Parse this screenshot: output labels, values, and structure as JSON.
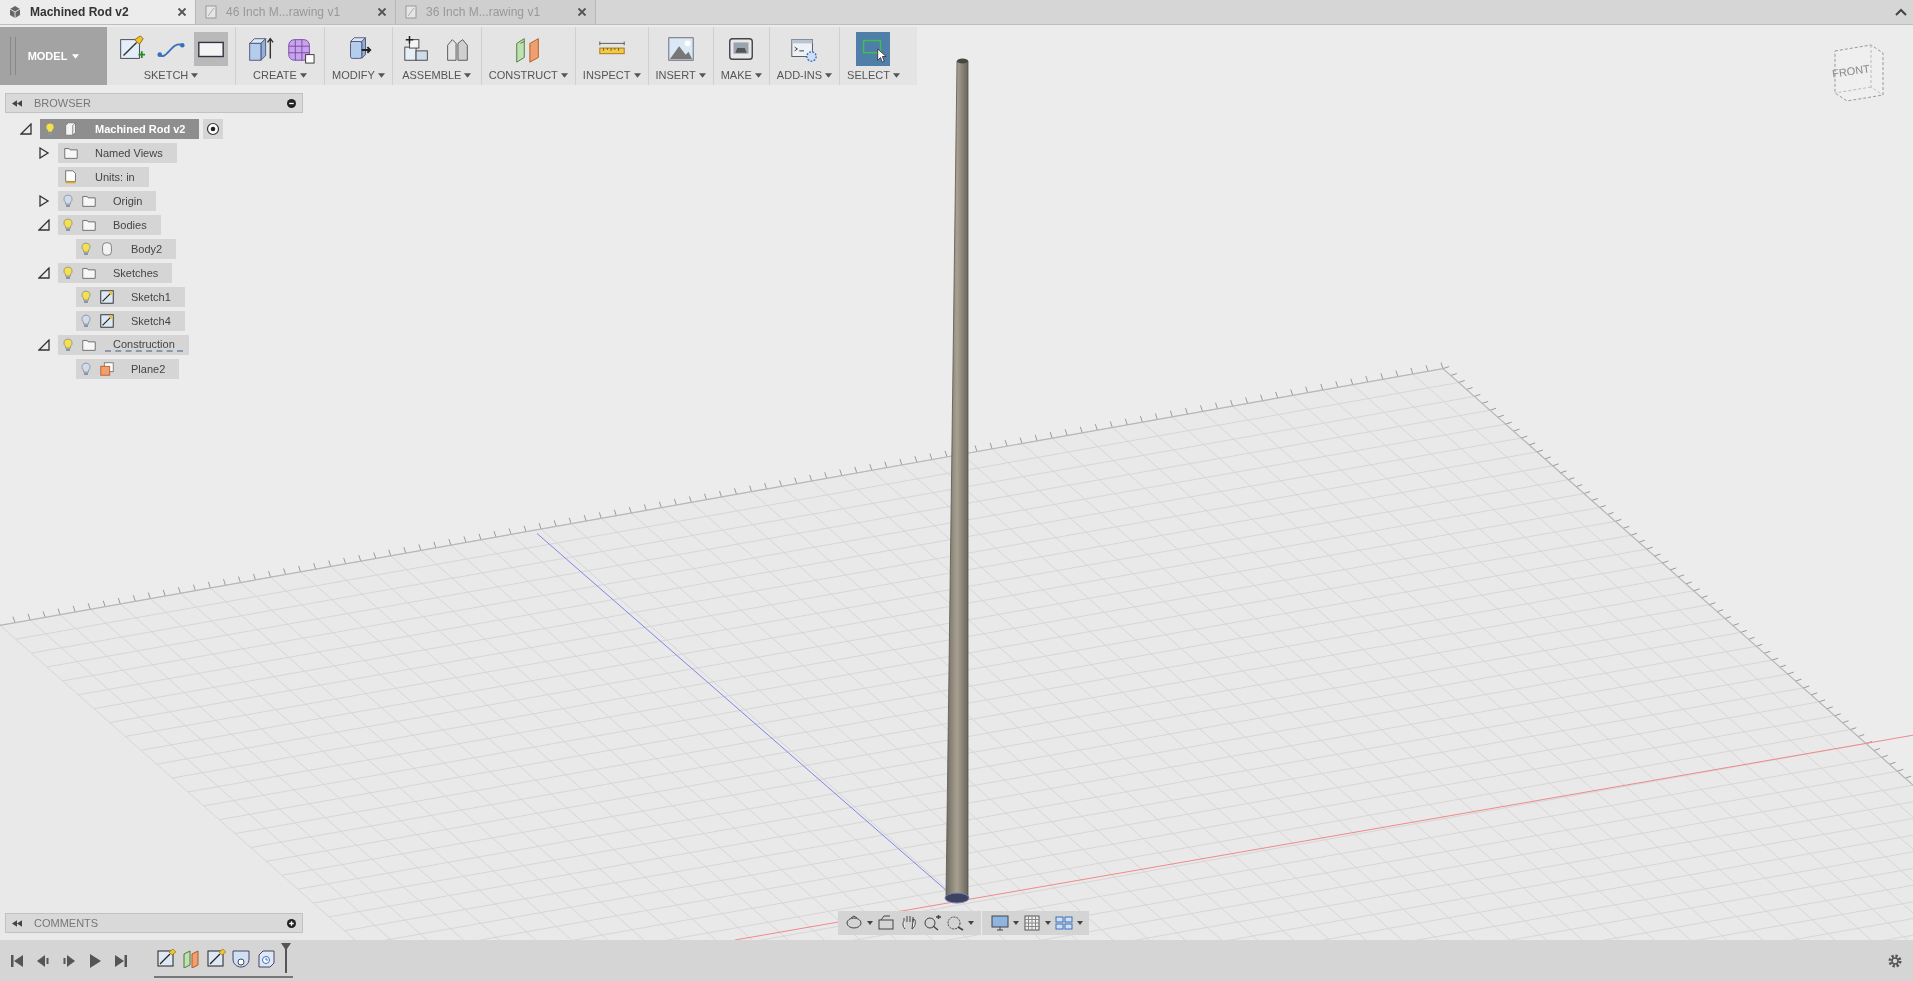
{
  "tabs": [
    {
      "label": "Machined Rod v2",
      "kind": "model",
      "selected": true
    },
    {
      "label": "46 Inch M...rawing v1",
      "kind": "drawing",
      "selected": false
    },
    {
      "label": "36 Inch M...rawing v1",
      "kind": "drawing",
      "selected": false
    }
  ],
  "toolbar": {
    "workspace": "MODEL",
    "groups": [
      {
        "label": "SKETCH",
        "tools": [
          {
            "kind": "sketch",
            "selected": false
          },
          {
            "kind": "spline",
            "selected": false
          },
          {
            "kind": "rectangle",
            "selected": true
          }
        ]
      },
      {
        "label": "CREATE",
        "tools": [
          {
            "kind": "box",
            "selected": false
          },
          {
            "kind": "form",
            "selected": false
          }
        ]
      },
      {
        "label": "MODIFY",
        "tools": [
          {
            "kind": "presspull",
            "selected": false
          }
        ]
      },
      {
        "label": "ASSEMBLE",
        "tools": [
          {
            "kind": "component",
            "selected": false
          },
          {
            "kind": "joint",
            "selected": false
          }
        ]
      },
      {
        "label": "CONSTRUCT",
        "tools": [
          {
            "kind": "plane",
            "selected": false
          }
        ]
      },
      {
        "label": "INSPECT",
        "tools": [
          {
            "kind": "measure",
            "selected": false
          }
        ]
      },
      {
        "label": "INSERT",
        "tools": [
          {
            "kind": "image",
            "selected": false
          }
        ]
      },
      {
        "label": "MAKE",
        "tools": [
          {
            "kind": "printer",
            "selected": false
          }
        ]
      },
      {
        "label": "ADD-INS",
        "tools": [
          {
            "kind": "scripts",
            "selected": false
          }
        ]
      },
      {
        "label": "SELECT",
        "tools": [
          {
            "kind": "select",
            "selected": true
          }
        ]
      }
    ]
  },
  "browser": {
    "title": "BROWSER",
    "tree": [
      {
        "label": "Machined Rod v2",
        "kind": "component",
        "visible": true,
        "expanded": true,
        "selected": true,
        "children": [
          {
            "label": "Named Views",
            "kind": "folder",
            "expanded": false,
            "selected": false
          },
          {
            "label": "Units: in",
            "kind": "units",
            "selected": false
          },
          {
            "label": "Origin",
            "kind": "folder",
            "visible": false,
            "expanded": false,
            "selected": false
          },
          {
            "label": "Bodies",
            "kind": "folder",
            "visible": true,
            "expanded": true,
            "selected": false,
            "children": [
              {
                "label": "Body2",
                "kind": "body",
                "visible": true,
                "selected": false
              }
            ]
          },
          {
            "label": "Sketches",
            "kind": "folder",
            "visible": true,
            "expanded": true,
            "selected": false,
            "children": [
              {
                "label": "Sketch1",
                "kind": "sketch",
                "visible": true,
                "selected": false
              },
              {
                "label": "Sketch4",
                "kind": "sketch",
                "visible": false,
                "selected": false
              }
            ]
          },
          {
            "label": "Construction",
            "kind": "folder",
            "visible": true,
            "expanded": true,
            "selected": false,
            "children": [
              {
                "label": "Plane2",
                "kind": "plane",
                "visible": false,
                "selected": false
              }
            ]
          }
        ]
      }
    ]
  },
  "comments": {
    "title": "COMMENTS"
  },
  "view_cube": {
    "face": "FRONT"
  },
  "timeline": {
    "features": [
      {
        "kind": "sketch"
      },
      {
        "kind": "plane"
      },
      {
        "kind": "sketch"
      },
      {
        "kind": "revolve"
      },
      {
        "kind": "extrude"
      }
    ]
  }
}
